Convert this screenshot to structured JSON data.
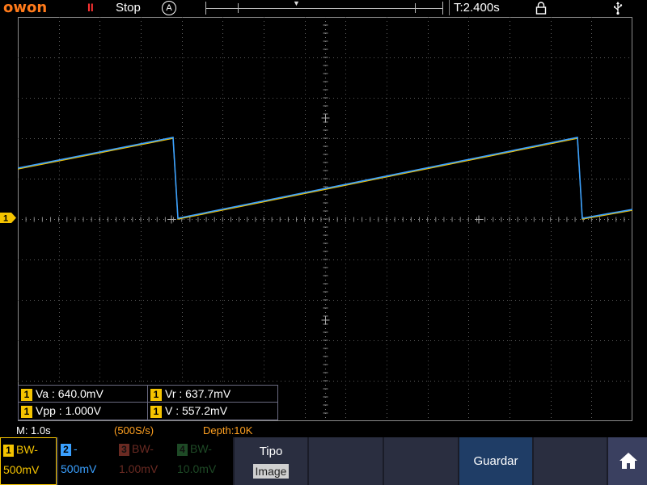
{
  "header": {
    "brand": "owon",
    "run_state_icon": "pause-icon",
    "run_state_text": "Stop",
    "trigger_mode_letter": "A",
    "trigger_time": "T:2.400s",
    "lock_icon": "lock-icon",
    "usb_icon": "usb-icon"
  },
  "colors": {
    "ch1": "#f5c400",
    "ch2": "#3aa0ff",
    "ch3": "#d03a2a",
    "ch4": "#2aa84a",
    "brand": "#ff7a1a",
    "status": "#ffa020",
    "menu_bg": "#2a2e40",
    "guardar_bg": "#1f3d66"
  },
  "ch1_marker": "1",
  "measurements": [
    {
      "ch": "1",
      "text": "Va : 640.0mV"
    },
    {
      "ch": "1",
      "text": "Vr : 637.7mV"
    },
    {
      "ch": "1",
      "text": "Vpp : 1.000V"
    },
    {
      "ch": "1",
      "text": "V : 557.2mV"
    }
  ],
  "status": {
    "timebase": "M: 1.0s",
    "sample_rate": "(500S/s)",
    "depth": "Depth:10K"
  },
  "channels": [
    {
      "num": "1",
      "line1": "BW-",
      "line2": "500mV"
    },
    {
      "num": "2",
      "line1": "-",
      "line2": "500mV"
    },
    {
      "num": "3",
      "line1": "BW-",
      "line2": "1.00mV"
    },
    {
      "num": "4",
      "line1": "BW-",
      "line2": "10.0mV"
    }
  ],
  "menu": {
    "tipo_label": "Tipo",
    "tipo_value": "Image",
    "save_label": "Guardar",
    "home_icon": "home-icon"
  }
}
